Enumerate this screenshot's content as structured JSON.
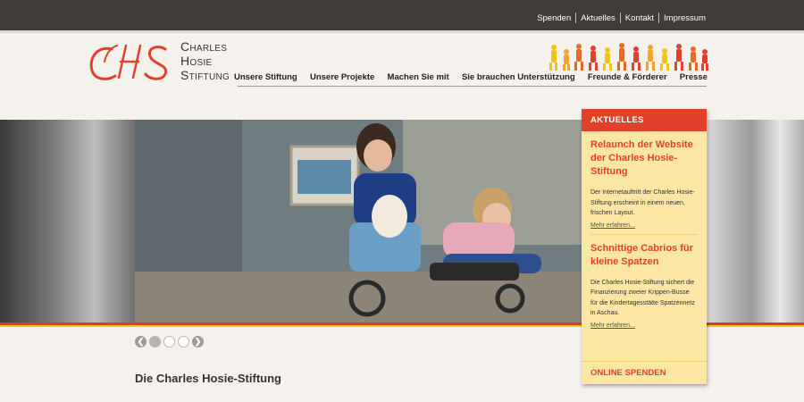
{
  "topnav": {
    "links": [
      "Spenden",
      "Aktuelles",
      "Kontakt",
      "Impressum"
    ]
  },
  "logo": {
    "monogram": "CHS",
    "line1": "Charles",
    "line2": "Hosie",
    "line3": "Stiftung"
  },
  "mainnav": {
    "items": [
      "Unsere Stiftung",
      "Unsere Projekte",
      "Machen Sie mit",
      "Sie brauchen Unterstützung",
      "Freunde & Förderer",
      "Presse"
    ]
  },
  "slider": {
    "slide_count": 3,
    "active_slide": 1
  },
  "section_title": "Die Charles Hosie-Stiftung",
  "news": {
    "heading": "AKTUELLES",
    "items": [
      {
        "title": "Relaunch der Website der Charles Hosie-Stiftung",
        "text": "Der Internetauftritt der Charles Hosie-Stiftung erscheint in einem neuen, frischen Layout.",
        "more": "Mehr erfahren..."
      },
      {
        "title": "Schnittige Cabrios für kleine Spatzen",
        "text": "Die Charles Hosie-Stiftung sichert die Finanzierung zweier Krippen-Busse für die Kindertagesstätte Spatzennetz in Aschau.",
        "more": "Mehr erfahren..."
      }
    ],
    "donate": "ONLINE SPENDEN"
  },
  "colors": {
    "accent_red": "#e1402a",
    "accent_yellow": "#f2c417",
    "panel_bg": "#fbe7a3",
    "topbar_bg": "#403c3a"
  }
}
